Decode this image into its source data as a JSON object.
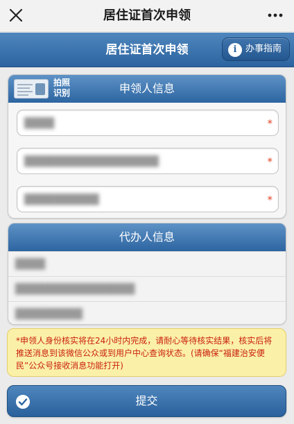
{
  "topbar": {
    "title": "居住证首次申领",
    "close_icon": "close-icon",
    "more_icon": "more-icon"
  },
  "header": {
    "title": "居住证首次申领",
    "guide_label": "办事指南",
    "guide_icon": "info-icon"
  },
  "applicant": {
    "title": "申领人信息",
    "scan_label_1": "拍照",
    "scan_label_2": "识别",
    "fields": [
      {
        "value": "████",
        "required_mark": "*"
      },
      {
        "value": "██████████████████",
        "required_mark": "*"
      },
      {
        "value": "██████████",
        "required_mark": "*"
      }
    ]
  },
  "agent": {
    "title": "代办人信息",
    "rows": [
      {
        "value": "████"
      },
      {
        "value": "████████████████"
      },
      {
        "value": "█████████"
      }
    ]
  },
  "notice": {
    "text": "*申领人身份核实将在24小时内完成，请耐心等待核实结果，核实后将推送消息到该微信公众或到用户中心查询状态。(请确保“福建治安便民”公众号接收消息功能打开)"
  },
  "submit": {
    "label": "提交"
  },
  "colors": {
    "brand_blue": "#2b64a0",
    "notice_bg": "#fbf0a8",
    "notice_text": "#c9210e",
    "required": "#e0492a"
  }
}
